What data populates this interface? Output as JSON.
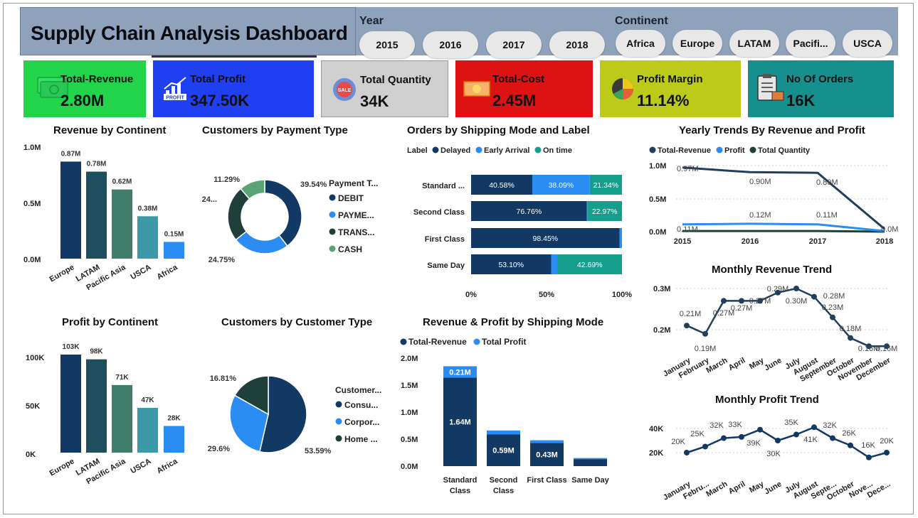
{
  "header": {
    "title": "Supply Chain Analysis Dashboard"
  },
  "filters": {
    "year_label": "Year",
    "years": [
      "2015",
      "2016",
      "2017",
      "2018"
    ],
    "continent_label": "Continent",
    "continents": [
      "Africa",
      "Europe",
      "LATAM",
      "Pacifi...",
      "USCA"
    ]
  },
  "kpis": [
    {
      "label": "Total-Revenue",
      "value": "2.80M",
      "bg": "#22d44a",
      "icon": "money-icon"
    },
    {
      "label": "Total Profit",
      "value": "347.50K",
      "bg": "#1f3ff0",
      "icon": "profit-chart-icon",
      "icon_text": "PROFIT"
    },
    {
      "label": "Total Quantity",
      "value": "34K",
      "bg": "#cfcfcf",
      "icon": "sale-badge-icon",
      "icon_text": "SALE"
    },
    {
      "label": "Total-Cost",
      "value": "2.45M",
      "bg": "#dd1212",
      "icon": "cash-icon"
    },
    {
      "label": "Profit Margin",
      "value": "11.14%",
      "bg": "#bccb1a",
      "icon": "margin-pie-icon"
    },
    {
      "label": "No Of Orders",
      "value": "16K",
      "bg": "#16908f",
      "icon": "orders-clipboard-icon"
    }
  ],
  "colors": {
    "navy": "#123963",
    "dark_teal": "#1f4e5e",
    "green_teal": "#417d6b",
    "teal": "#3d98a8",
    "blue": "#2b8cf4",
    "green": "#5aa374",
    "sea": "#159e8d",
    "dark_green": "#1f3f3a"
  },
  "chart_data": [
    {
      "id": "revenue_by_continent",
      "type": "bar",
      "title": "Revenue by Continent",
      "categories": [
        "Europe",
        "LATAM",
        "Pacific Asia",
        "USCA",
        "Africa"
      ],
      "values": [
        0.87,
        0.78,
        0.62,
        0.38,
        0.15
      ],
      "labels": [
        "0.87M",
        "0.78M",
        "0.62M",
        "0.38M",
        "0.15M"
      ],
      "yticks": [
        "0.0M",
        "0.5M",
        "1.0M"
      ],
      "ylim": [
        0,
        1.0
      ],
      "colors": [
        "#123963",
        "#1f4e5e",
        "#417d6b",
        "#3d98a8",
        "#2b8cf4"
      ]
    },
    {
      "id": "profit_by_continent",
      "type": "bar",
      "title": "Profit by Continent",
      "categories": [
        "Europe",
        "LATAM",
        "Pacific Asia",
        "USCA",
        "Africa"
      ],
      "values": [
        103,
        98,
        71,
        47,
        28
      ],
      "labels": [
        "103K",
        "98K",
        "71K",
        "47K",
        "28K"
      ],
      "yticks": [
        "0K",
        "50K",
        "100K"
      ],
      "ylim": [
        0,
        100
      ],
      "colors": [
        "#123963",
        "#1f4e5e",
        "#417d6b",
        "#3d98a8",
        "#2b8cf4"
      ]
    },
    {
      "id": "customers_by_payment",
      "type": "donut",
      "title": "Customers by Payment Type",
      "legend_title": "Payment T...",
      "slices": [
        {
          "name": "DEBIT",
          "value": 39.54,
          "label": "39.54%",
          "color": "#123963"
        },
        {
          "name": "PAYME...",
          "value": 24.75,
          "label": "24.75%",
          "color": "#2b8cf4"
        },
        {
          "name": "TRANS...",
          "value": 24.46,
          "label": "24...",
          "color": "#1f3f3a"
        },
        {
          "name": "CASH",
          "value": 11.29,
          "label": "11.29%",
          "color": "#5aa374"
        }
      ]
    },
    {
      "id": "customers_by_type",
      "type": "pie",
      "title": "Customers by Customer Type",
      "legend_title": "Customer...",
      "slices": [
        {
          "name": "Consu...",
          "value": 53.59,
          "label": "53.59%",
          "color": "#123963"
        },
        {
          "name": "Corpor...",
          "value": 29.6,
          "label": "29.6%",
          "color": "#2b8cf4"
        },
        {
          "name": "Home ...",
          "value": 16.81,
          "label": "16.81%",
          "color": "#1f3f3a"
        }
      ]
    },
    {
      "id": "orders_by_shipping",
      "type": "stacked_bar_100",
      "title": "Orders by Shipping Mode and Label",
      "legend_title": "Label",
      "series": [
        {
          "name": "Delayed",
          "color": "#123963"
        },
        {
          "name": "Early Arrival",
          "color": "#2b8cf4"
        },
        {
          "name": "On time",
          "color": "#159e8d"
        }
      ],
      "rows": [
        {
          "name": "Standard ...",
          "values": [
            40.58,
            38.09,
            21.34
          ],
          "labels": [
            "40.58%",
            "38.09%",
            "21.34%"
          ]
        },
        {
          "name": "Second Class",
          "values": [
            76.76,
            0.27,
            22.97
          ],
          "labels": [
            "76.76%",
            "",
            "22.97%"
          ]
        },
        {
          "name": "First Class",
          "values": [
            98.45,
            1.55,
            0
          ],
          "labels": [
            "98.45%",
            "",
            ""
          ]
        },
        {
          "name": "Same Day",
          "values": [
            53.1,
            4.21,
            42.69
          ],
          "labels": [
            "53.10%",
            "",
            "42.69%"
          ]
        }
      ],
      "xticks": [
        "0%",
        "50%",
        "100%"
      ]
    },
    {
      "id": "revenue_profit_by_shipping",
      "type": "stacked_bar",
      "title": "Revenue & Profit by Shipping Mode",
      "categories": [
        "Standard Class",
        "Second Class",
        "First Class",
        "Same Day"
      ],
      "series": [
        {
          "name": "Total-Revenue",
          "values": [
            1.64,
            0.59,
            0.43,
            0.13
          ],
          "labels": [
            "1.64M",
            "0.59M",
            "0.43M",
            ""
          ],
          "color": "#123963"
        },
        {
          "name": "Total Profit",
          "values": [
            0.21,
            0.07,
            0.05,
            0.02
          ],
          "labels": [
            "0.21M",
            "",
            "",
            ""
          ],
          "color": "#2b8cf4"
        }
      ],
      "yticks": [
        "0.0M",
        "0.5M",
        "1.0M",
        "1.5M",
        "2.0M"
      ],
      "ylim": [
        0,
        2.0
      ]
    },
    {
      "id": "yearly_trends",
      "type": "line",
      "title": "Yearly Trends By Revenue and Profit",
      "x": [
        "2015",
        "2016",
        "2017",
        "2018"
      ],
      "series": [
        {
          "name": "Total-Revenue",
          "values": [
            0.97,
            0.9,
            0.89,
            0.04
          ],
          "labels": [
            "0.97M",
            "0.90M",
            "0.89M",
            "0.0M"
          ],
          "color": "#1f3f5e"
        },
        {
          "name": "Profit",
          "values": [
            0.11,
            0.12,
            0.11,
            0.01
          ],
          "labels": [
            "0.11M",
            "0.12M",
            "0.11M",
            ""
          ],
          "color": "#2b8cf4"
        },
        {
          "name": "Total Quantity",
          "values": [
            0.01,
            0.01,
            0.01,
            0.0
          ],
          "labels": [],
          "color": "#1f3f3a"
        }
      ],
      "yticks": [
        "0.0M",
        "0.5M",
        "1.0M"
      ],
      "ylim": [
        0,
        1.0
      ]
    },
    {
      "id": "monthly_revenue",
      "type": "line",
      "title": "Monthly Revenue Trend",
      "x": [
        "January",
        "February",
        "March",
        "April",
        "May",
        "June",
        "July",
        "August",
        "September",
        "October",
        "November",
        "December"
      ],
      "values": [
        0.21,
        0.19,
        0.27,
        0.27,
        0.27,
        0.29,
        0.3,
        0.28,
        0.23,
        0.18,
        0.16,
        0.16
      ],
      "labels": [
        "0.21M",
        "0.19M",
        "0.27M",
        "0.27M",
        "0.27M",
        "0.29M",
        "0.30M",
        "0.28M",
        "0.23M",
        "0.18M",
        "0.16M",
        "0.16M"
      ],
      "yticks": [
        "0.2M",
        "0.3M"
      ],
      "ylim": [
        0.2,
        0.3
      ],
      "color": "#1f3f5e"
    },
    {
      "id": "monthly_profit",
      "type": "line",
      "title": "Monthly Profit Trend",
      "x": [
        "January",
        "Febru...",
        "March",
        "April",
        "May",
        "June",
        "July",
        "August",
        "Septe...",
        "October",
        "Nove...",
        "Dece..."
      ],
      "values": [
        20,
        25,
        32,
        33,
        39,
        30,
        35,
        41,
        32,
        26,
        16,
        20
      ],
      "labels": [
        "20K",
        "25K",
        "32K",
        "33K",
        "39K",
        "30K",
        "35K",
        "41K",
        "32K",
        "26K",
        "16K",
        "20K"
      ],
      "yticks": [
        "20K",
        "40K"
      ],
      "ylim": [
        20,
        40
      ],
      "color": "#123963"
    }
  ]
}
